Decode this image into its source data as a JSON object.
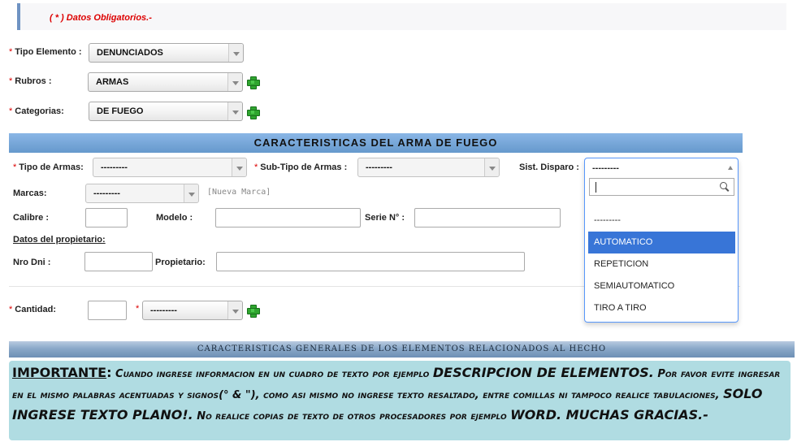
{
  "notice": {
    "text": "( * ) Datos Obligatorios.-"
  },
  "required_mark": "*",
  "form": {
    "tipo_elemento": {
      "label": "Tipo Elemento :",
      "value": "DENUNCIADOS"
    },
    "rubros": {
      "label": "Rubros :",
      "value": "ARMAS"
    },
    "categorias": {
      "label": "Categorias:",
      "value": "DE FUEGO"
    }
  },
  "arma_section": {
    "title": "CARACTERISTICAS DEL ARMA DE FUEGO",
    "tipo_armas": {
      "label": "Tipo de Armas:",
      "value": "---------"
    },
    "sub_tipo": {
      "label": "Sub-Tipo de Armas :",
      "value": "---------"
    },
    "sist_disparo": {
      "label": "Sist. Disparo :",
      "value": "---------"
    },
    "marcas": {
      "label": "Marcas:",
      "value": "---------",
      "nueva_link": "[Nueva Marca]"
    },
    "calibre": {
      "label": "Calibre :",
      "value": ""
    },
    "modelo": {
      "label": "Modelo :",
      "value": ""
    },
    "serie": {
      "label": "Serie N° :",
      "value": ""
    },
    "propietario_heading": "Datos del propietario:",
    "nro_dni": {
      "label": "Nro Dni :",
      "value": ""
    },
    "propietario": {
      "label": "Propietario:",
      "value": ""
    }
  },
  "cantidad": {
    "label": "Cantidad:",
    "value": "",
    "unit_value": "---------"
  },
  "dropdown": {
    "options": [
      "---------",
      "AUTOMATICO",
      "REPETICION",
      "SEMIAUTOMATICO",
      "TIRO A TIRO"
    ],
    "highlighted": "AUTOMATICO",
    "search_value": ""
  },
  "general_section": {
    "title": "CARACTERISTICAS GENERALES DE LOS ELEMENTOS RELACIONADOS AL HECHO"
  },
  "important": {
    "title": "IMPORTANTE",
    "p1": "Cuando ingrese informacion en un cuadro de texto por ejemplo",
    "b1": "DESCRIPCION DE ELEMENTOS.",
    "p2": "Por favor evite ingresar en el mismo palabras acentuadas y signos(° & \"), como asi mismo no ingrese texto resaltado, entre comillas ni tampoco realice tabulaciones,",
    "b2": "SOLO INGRESE TEXTO PLANO!.",
    "p3": "No realice copias de texto de otros procesadores por ejemplo",
    "b3": "WORD. MUCHAS GRACIAS.-"
  },
  "colors": {
    "accent": "#6699cc",
    "required": "#dd0000",
    "highlight": "#3875d7",
    "info_bg": "#b0dce2",
    "add": "#2fa52f"
  }
}
